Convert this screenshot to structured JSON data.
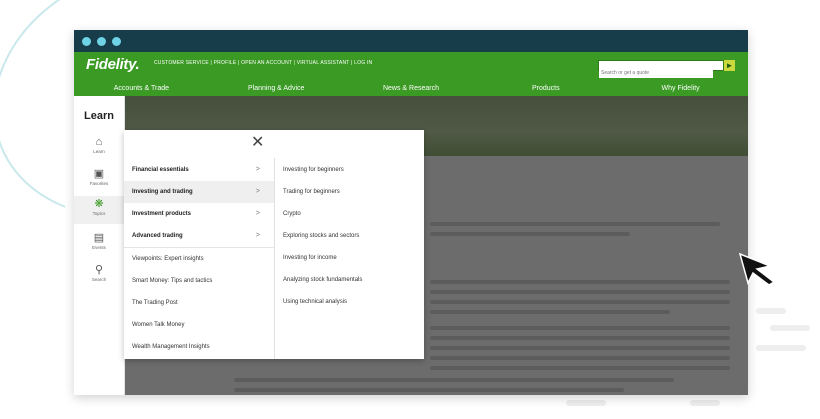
{
  "colors": {
    "brand_green": "#3a9a24",
    "title_bar": "#173c4a",
    "traffic_dot": "#6fd3e6",
    "search_btn": "#c9d83d"
  },
  "header": {
    "logo": "Fidelity.",
    "top_links": "CUSTOMER SERVICE | PROFILE | OPEN AN ACCOUNT | VIRTUAL ASSISTANT | LOG IN",
    "search_placeholder": "Search or get a quote",
    "search_icon": "search-icon"
  },
  "main_nav": [
    "Accounts & Trade",
    "Planning & Advice",
    "News & Research",
    "Products",
    "Why Fidelity"
  ],
  "learn_bar": {
    "title": "Learn",
    "items": [
      {
        "label": "Learn",
        "icon": "home-icon"
      },
      {
        "label": "Favorites",
        "icon": "bookmark-icon"
      },
      {
        "label": "Topics",
        "icon": "topics-icon"
      },
      {
        "label": "Events",
        "icon": "calendar-icon"
      },
      {
        "label": "Search",
        "icon": "search-icon"
      }
    ]
  },
  "menu": {
    "close_icon": "close-icon",
    "categories": [
      {
        "label": "Financial essentials",
        "chevron": ">"
      },
      {
        "label": "Investing and trading",
        "chevron": ">"
      },
      {
        "label": "Investment products",
        "chevron": ">"
      },
      {
        "label": "Advanced trading",
        "chevron": ">"
      }
    ],
    "links": [
      "Viewpoints: Expert insights",
      "Smart Money: Tips and tactics",
      "The Trading Post",
      "Women Talk Money",
      "Wealth Management Insights"
    ],
    "sub_items": [
      "Investing for beginners",
      "Trading for beginners",
      "Crypto",
      "Exploring stocks and sectors",
      "Investing for income",
      "Analyzing stock fundamentals",
      "Using technical analysis"
    ]
  }
}
